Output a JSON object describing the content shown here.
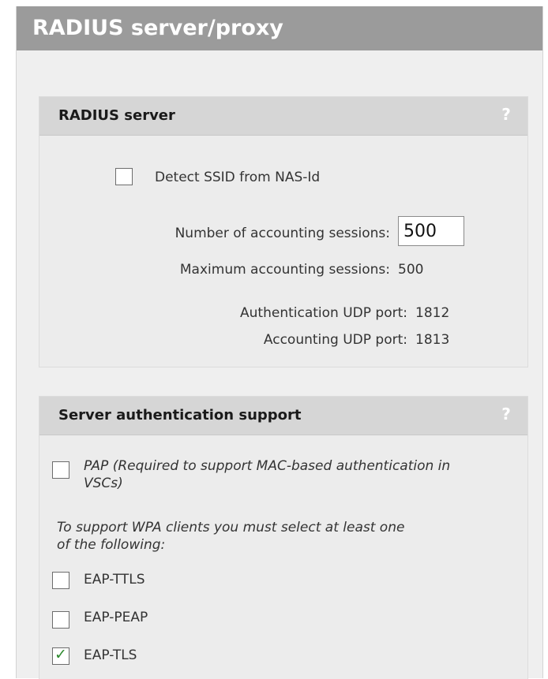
{
  "page_title": "RADIUS server/proxy",
  "radius_server": {
    "title": "RADIUS server",
    "help": "?",
    "detect_ssid_label": "Detect SSID from NAS-Id",
    "detect_ssid_checked": false,
    "num_sessions_label": "Number of accounting sessions:",
    "num_sessions_value": "500",
    "max_sessions_label": "Maximum accounting sessions:",
    "max_sessions_value": "500",
    "auth_port_label": "Authentication UDP port:",
    "auth_port_value": "1812",
    "acct_port_label": "Accounting UDP port:",
    "acct_port_value": "1813"
  },
  "server_auth": {
    "title": "Server authentication support",
    "help": "?",
    "pap_label_line1": "PAP (Required to support MAC-based authentication in",
    "pap_label_line2": "VSCs)",
    "pap_checked": false,
    "wpa_note_line1": "To support WPA clients you must select at least one",
    "wpa_note_line2": "of the following:",
    "eap_ttls_label": "EAP-TTLS",
    "eap_ttls_checked": false,
    "eap_peap_label": "EAP-PEAP",
    "eap_peap_checked": false,
    "eap_tls_label": "EAP-TLS",
    "eap_tls_checked": true
  }
}
